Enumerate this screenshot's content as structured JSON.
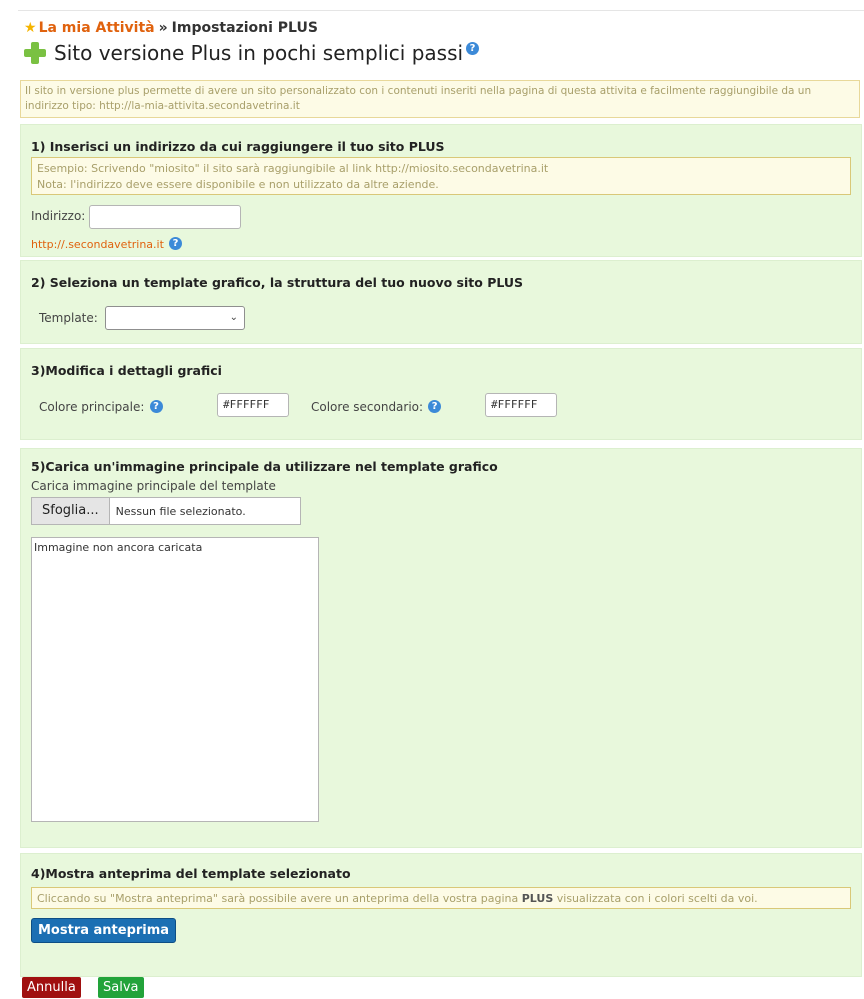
{
  "breadcrumb": {
    "link": "La mia Attività",
    "separator": "»",
    "current": "Impostazioni PLUS"
  },
  "page_title": "Sito versione Plus in pochi semplici passi",
  "intro": "Il sito in versione plus permette di avere un sito personalizzato con i contenuti inseriti nella pagina di questa attivita e facilmente raggiungibile da un indirizzo tipo: http://la-mia-attivita.secondavetrina.it",
  "step1": {
    "title": "1) Inserisci un indirizzo da cui raggiungere il tuo sito PLUS",
    "note_line1": "Esempio: Scrivendo \"miosito\" il sito sarà raggiungibile al link http://miosito.secondavetrina.it",
    "note_line2": "Nota: l'indirizzo deve essere disponibile e non utilizzato da altre aziende.",
    "address_label": "Indirizzo:",
    "address_value": "",
    "url_preview": "http://.secondavetrina.it"
  },
  "step2": {
    "title": "2) Seleziona un template grafico, la struttura del tuo nuovo sito PLUS",
    "template_label": "Template:",
    "template_value": ""
  },
  "step3": {
    "title": "3)Modifica i dettagli grafici",
    "primary_label": "Colore principale:",
    "primary_value": "#FFFFFF",
    "secondary_label": "Colore secondario:",
    "secondary_value": "#FFFFFF"
  },
  "step5": {
    "title": "5)Carica un'immagine principale da utilizzare nel template grafico",
    "upload_label": "Carica immagine principale del template",
    "browse_button": "Sfoglia...",
    "no_file": "Nessun file selezionato.",
    "image_placeholder": "Immagine non ancora caricata"
  },
  "step4": {
    "title": "4)Mostra anteprima del template selezionato",
    "note_before": "Cliccando su \"Mostra anteprima\" sarà possibile avere un anteprima della vostra pagina ",
    "note_bold": "PLUS",
    "note_after": " visualizzata con i colori scelti da voi.",
    "preview_button": "Mostra anteprima"
  },
  "actions": {
    "cancel": "Annulla",
    "save": "Salva"
  },
  "colors": {
    "section_bg": "#e8f8dc",
    "note_bg": "#fdfbe6",
    "accent_orange": "#e0620e",
    "help_icon": "#3c8ad8"
  }
}
